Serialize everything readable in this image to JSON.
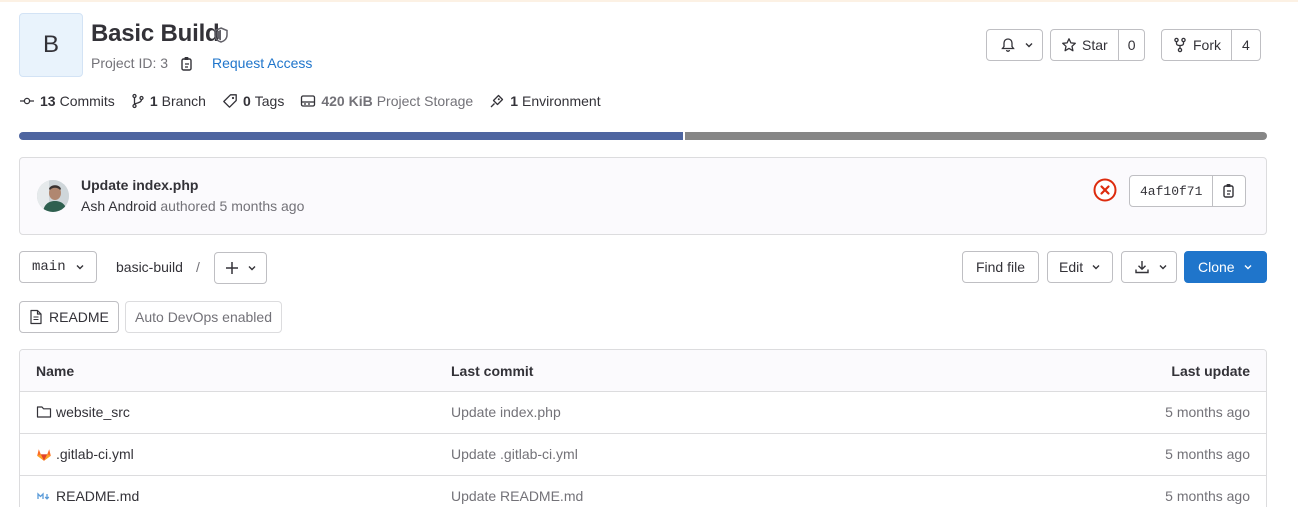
{
  "project": {
    "avatar_letter": "B",
    "title": "Basic Build",
    "id_label": "Project ID: 3",
    "request_access": "Request Access"
  },
  "actions": {
    "star_label": "Star",
    "star_count": "0",
    "fork_label": "Fork",
    "fork_count": "4"
  },
  "stats": {
    "commits_count": "13",
    "commits_label": "Commits",
    "branch_count": "1",
    "branch_label": "Branch",
    "tags_count": "0",
    "tags_label": "Tags",
    "storage_size": "420 KiB",
    "storage_label": "Project Storage",
    "env_count": "1",
    "env_label": "Environment"
  },
  "language_bar": {
    "segments": [
      {
        "color": "#4e65a0",
        "fraction": 0.532
      },
      {
        "color": "#868686",
        "fraction": 0.468
      }
    ]
  },
  "last_commit": {
    "title": "Update index.php",
    "author": "Ash Android",
    "meta": "authored 5 months ago",
    "sha": "4af10f71",
    "status_color": "#dd2b0e"
  },
  "repo_nav": {
    "branch": "main",
    "path": "basic-build",
    "separator": "/",
    "find_file": "Find file",
    "edit": "Edit",
    "clone": "Clone"
  },
  "badges": {
    "readme": "README",
    "devops": "Auto DevOps enabled"
  },
  "table": {
    "headers": {
      "name": "Name",
      "last_commit": "Last commit",
      "last_update": "Last update"
    },
    "rows": [
      {
        "name": "website_src",
        "icon": "folder-icon",
        "commit": "Update index.php",
        "when": "5 months ago"
      },
      {
        "name": ".gitlab-ci.yml",
        "icon": "gitlab-icon",
        "commit": "Update .gitlab-ci.yml",
        "when": "5 months ago"
      },
      {
        "name": "README.md",
        "icon": "markdown-icon",
        "commit": "Update README.md",
        "when": "5 months ago"
      }
    ]
  }
}
